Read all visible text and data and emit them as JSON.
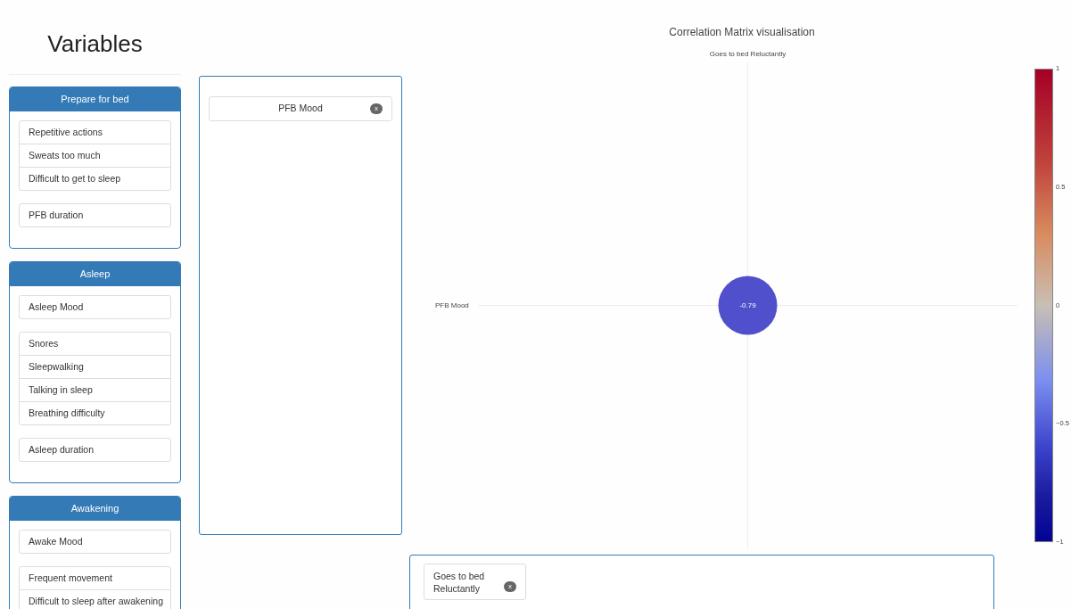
{
  "sidebar": {
    "title": "Variables",
    "groups": [
      {
        "title": "Prepare for bed",
        "sections": [
          [
            "Repetitive actions",
            "Sweats too much",
            "Difficult to get to sleep"
          ],
          [
            "PFB duration"
          ]
        ]
      },
      {
        "title": "Asleep",
        "sections": [
          [
            "Asleep Mood"
          ],
          [
            "Snores",
            "Sleepwalking",
            "Talking in sleep",
            "Breathing difficulty"
          ],
          [
            "Asleep duration"
          ]
        ]
      },
      {
        "title": "Awakening",
        "sections": [
          [
            "Awake Mood"
          ],
          [
            "Frequent movement",
            "Difficult to sleep after awakening"
          ]
        ]
      }
    ]
  },
  "row_variables": [
    {
      "label": "PFB Mood",
      "remove": "x"
    }
  ],
  "column_variables": [
    {
      "label": "Goes to bed Reluctantly",
      "remove": "x"
    }
  ],
  "chart": {
    "title": "Correlation Matrix visualisation",
    "column_labels": [
      "Goes to bed Reluctantly"
    ],
    "row_labels": [
      "PFB Mood"
    ],
    "cells": [
      {
        "value": "-0.79",
        "color": "#5050cc"
      }
    ],
    "colorbar_ticks": [
      "1",
      "0.5",
      "0",
      "−0.5",
      "−1"
    ]
  }
}
